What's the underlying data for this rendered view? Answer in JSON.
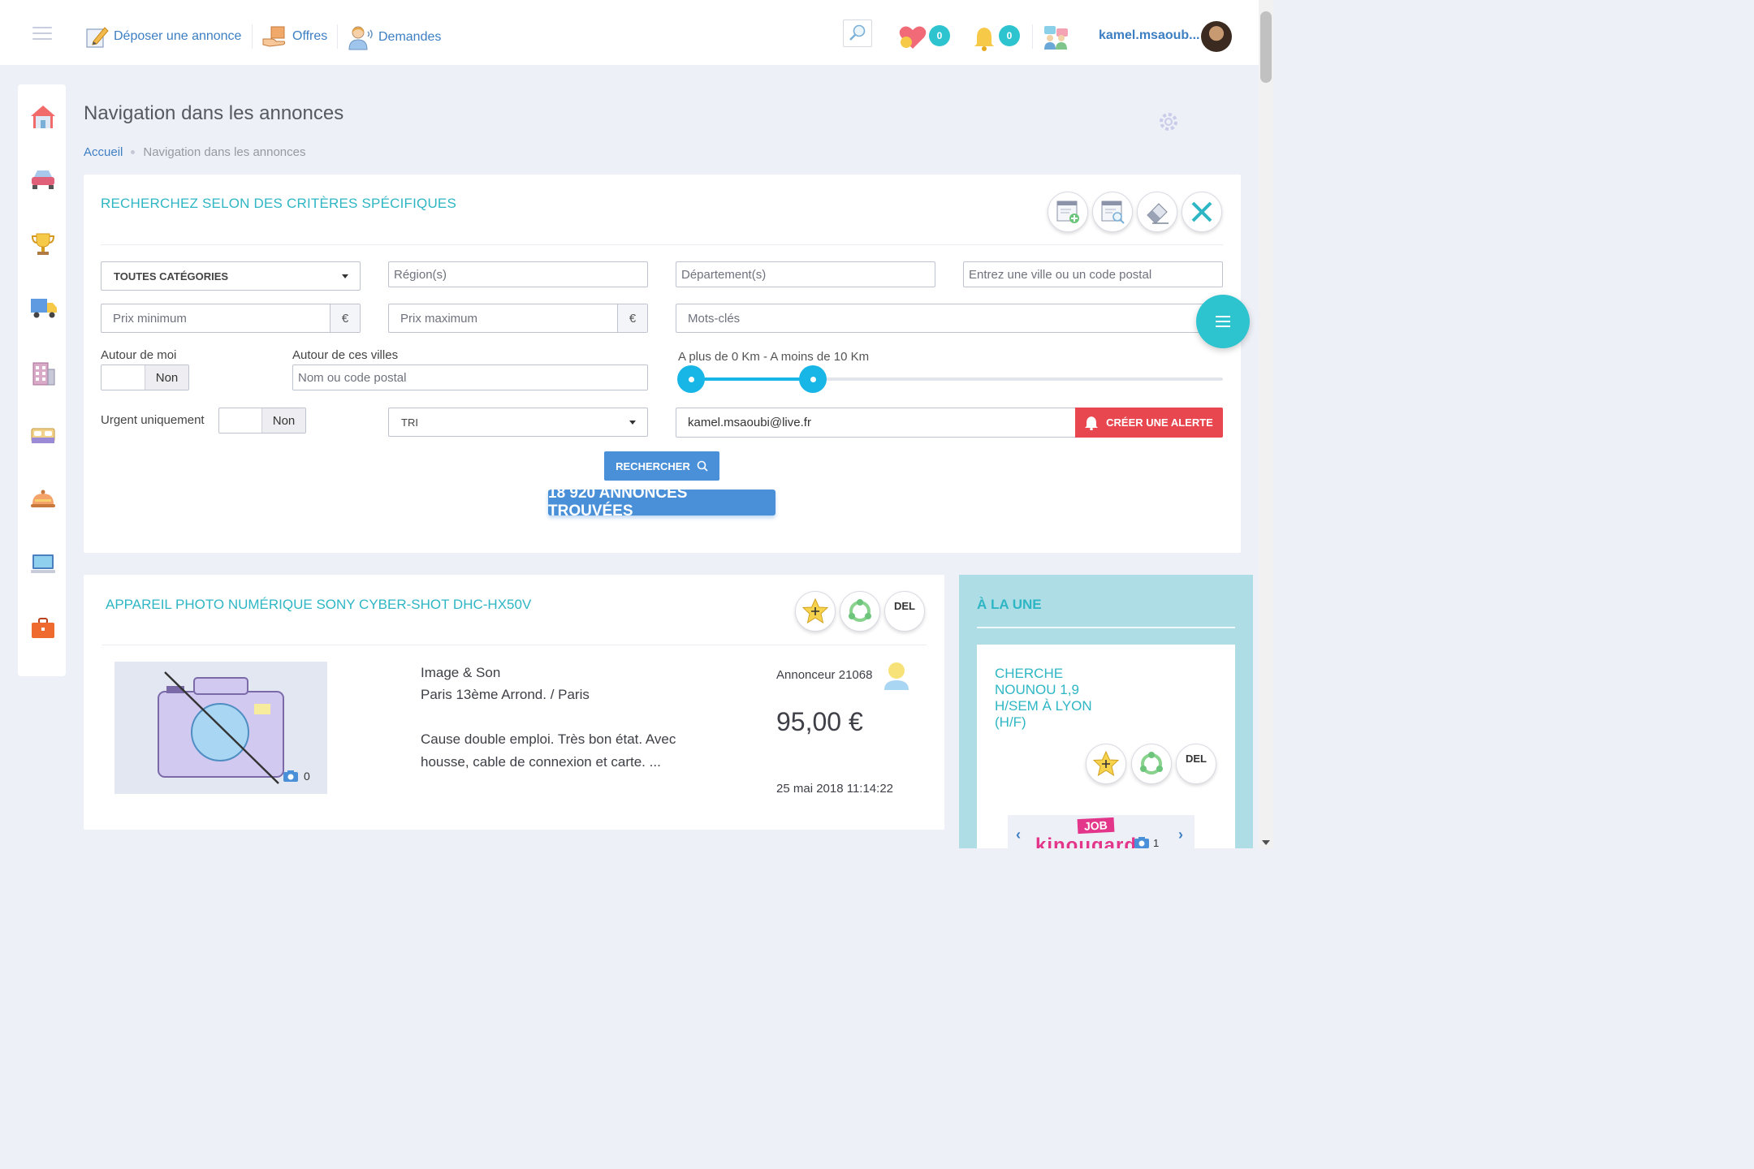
{
  "topbar": {
    "nav": [
      {
        "label": "Déposer une annonce",
        "icon": "pencil-icon"
      },
      {
        "label": "Offres",
        "icon": "box-hand-icon"
      },
      {
        "label": "Demandes",
        "icon": "person-speaking-icon"
      }
    ],
    "favorites_count": "0",
    "notifications_count": "0",
    "username": "kamel.msaoub..."
  },
  "sidebar": {
    "items": [
      "home-icon",
      "car-icon",
      "trophy-icon",
      "truck-icon",
      "building-icon",
      "bed-icon",
      "cloche-icon",
      "computer-icon",
      "briefcase-icon"
    ]
  },
  "page": {
    "title": "Navigation dans les annonces",
    "breadcrumb": {
      "home": "Accueil",
      "current": "Navigation dans les annonces"
    }
  },
  "search": {
    "title": "RECHERCHEZ SELON DES CRITÈRES SPÉCIFIQUES",
    "category": "TOUTES CATÉGORIES",
    "region_placeholder": "Région(s)",
    "departement_placeholder": "Département(s)",
    "city_placeholder": "Entrez une ville ou un code postal",
    "price_min_placeholder": "Prix minimum",
    "price_max_placeholder": "Prix maximum",
    "currency": "€",
    "keywords_placeholder": "Mots-clés",
    "around_me_label": "Autour de moi",
    "around_me_value": "Non",
    "around_cities_label": "Autour de ces villes",
    "around_cities_placeholder": "Nom ou code postal",
    "range_label": "A plus de 0 Km - A moins de 10 Km",
    "range_min_km": 0,
    "range_max_km": 10,
    "range_scale_max_km": 43,
    "urgent_label": "Urgent uniquement",
    "urgent_value": "Non",
    "sort_value": "TRI",
    "email_value": "kamel.msaoubi@live.fr",
    "alert_button": "CRÉER UNE ALERTE",
    "search_button": "RECHERCHER",
    "results": "18 920  ANNONCES TROUVÉES"
  },
  "listing": {
    "title": "APPAREIL PHOTO NUMÉRIQUE SONY CYBER-SHOT DHC-HX50V",
    "del_label": "DEL",
    "photo_count": "0",
    "category": "Image & Son",
    "location": "Paris 13ème Arrond. / Paris",
    "description_line1": "Cause double emploi. Très bon état. Avec",
    "description_line2": "housse, cable de connexion et carte.   ...",
    "advertiser": "Annonceur 21068",
    "price": "95,00  €",
    "date": "25 mai 2018 11:14:22"
  },
  "featured": {
    "title": "À LA UNE",
    "card_title": "CHERCHE NOUNOU 1,9 H/SEM À LYON (H/F)",
    "del_label": "DEL",
    "photo_count": "1",
    "job_label": "JOB",
    "brand_fragment": "kinougarde"
  },
  "colors": {
    "accent": "#2eb6c4",
    "link": "#3d7fc3",
    "primary_button": "#4a90d9",
    "alert_button": "#e8474f",
    "slider": "#17b6e6"
  }
}
